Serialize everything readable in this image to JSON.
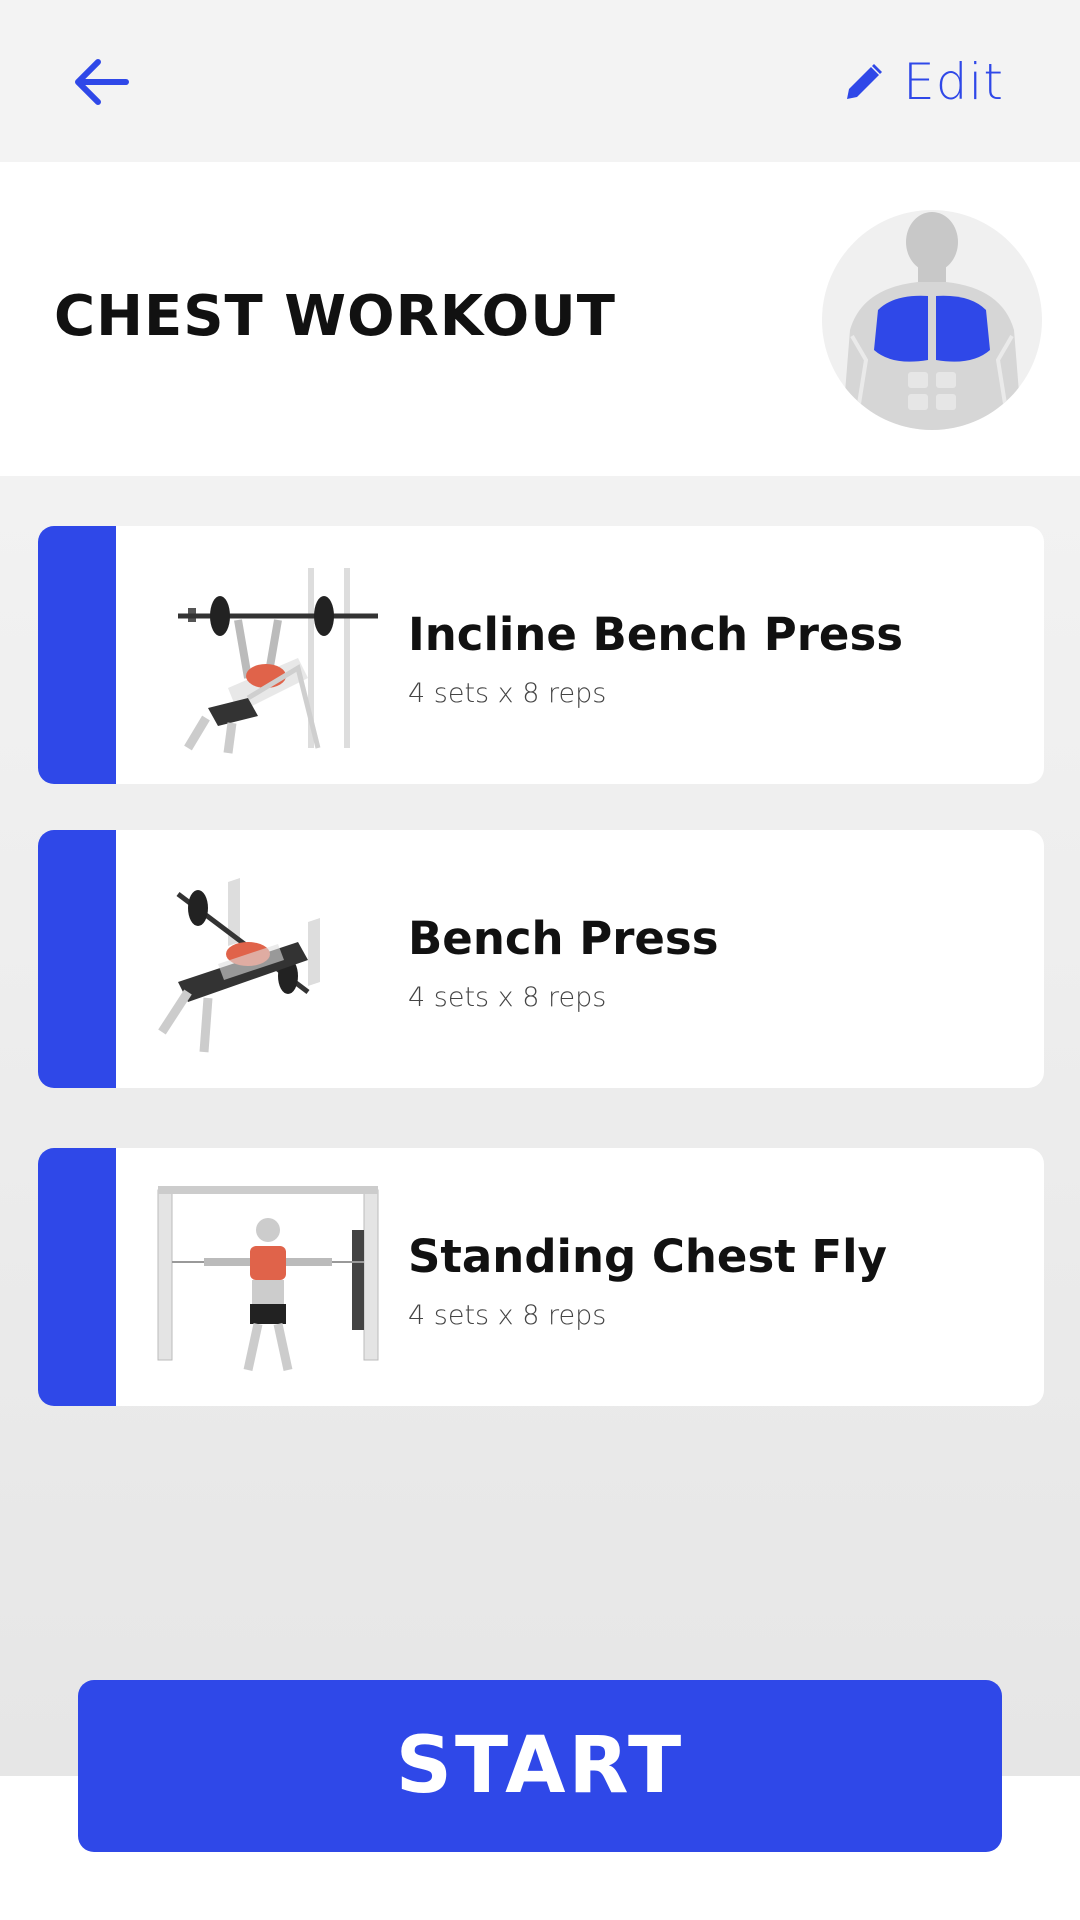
{
  "topbar": {
    "back_icon": "arrow-left-icon",
    "edit_icon": "pencil-icon",
    "edit_label": "Edit"
  },
  "header": {
    "title": "CHEST WORKOUT",
    "avatar_icon": "chest-muscle-icon"
  },
  "exercises": [
    {
      "name": "Incline Bench Press",
      "detail": "4 sets x 8 reps",
      "icon": "incline-bench-press-illustration"
    },
    {
      "name": "Bench Press",
      "detail": "4 sets x 8 reps",
      "icon": "bench-press-illustration"
    },
    {
      "name": "Standing Chest Fly",
      "detail": "4 sets x 8 reps",
      "icon": "cable-chest-fly-illustration"
    }
  ],
  "start_label": "START",
  "colors": {
    "accent": "#2f48e8",
    "highlight_muscle": "#e0634a"
  }
}
